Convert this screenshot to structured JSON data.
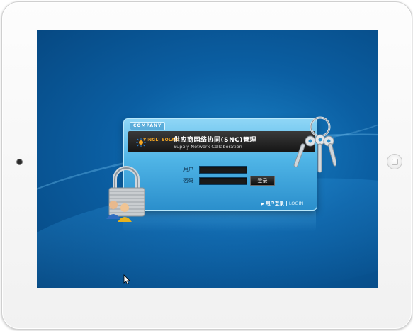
{
  "device": {
    "camera_icon": "camera-icon",
    "home_button_icon": "home-button-icon"
  },
  "login": {
    "company_tag": "COMPANY",
    "logo_text": "YINGLI SOLAR",
    "system_title": "供应商网络协同(SNC)管理",
    "system_subtitle": "Supply Network Collaboration",
    "username_label": "用户",
    "password_label": "密码",
    "username_value": "",
    "password_value": "",
    "login_button": "登录",
    "footer_cn": "用户登录",
    "footer_en": "LOGIN"
  },
  "icons": {
    "lock": "lock-with-users-icon",
    "keys": "keys-icon",
    "cursor": "mouse-pointer-icon"
  },
  "colors": {
    "screen_bg": "#0b5fa3",
    "panel": "#4fb4e6",
    "banner": "#151515",
    "logo_accent": "#f4a623"
  }
}
